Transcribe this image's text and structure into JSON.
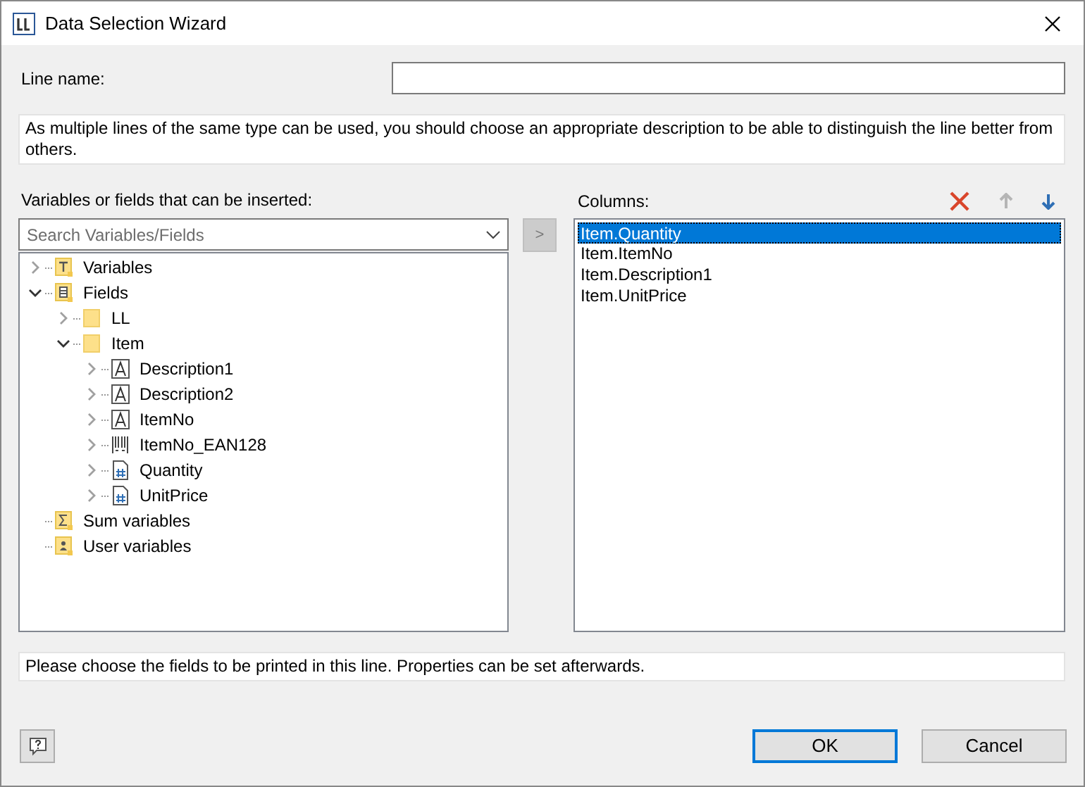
{
  "window": {
    "title": "Data Selection Wizard"
  },
  "line_name": {
    "label": "Line name:"
  },
  "description": "As multiple lines of the same type can be used, you should choose an appropriate description to be able to distinguish the line better from others.",
  "source": {
    "label": "Variables or fields that can be inserted:",
    "search_placeholder": "Search Variables/Fields",
    "add_button": ">",
    "tree": [
      {
        "label": "Variables",
        "kind": "variables",
        "expandable": true,
        "expanded": false
      },
      {
        "label": "Fields",
        "kind": "table",
        "expandable": true,
        "expanded": true,
        "children": [
          {
            "label": "LL",
            "kind": "folder",
            "expandable": true,
            "expanded": false
          },
          {
            "label": "Item",
            "kind": "folder",
            "expandable": true,
            "expanded": true,
            "children": [
              {
                "label": "Description1",
                "kind": "text",
                "expandable": true,
                "expanded": false
              },
              {
                "label": "Description2",
                "kind": "text",
                "expandable": true,
                "expanded": false
              },
              {
                "label": "ItemNo",
                "kind": "text",
                "expandable": true,
                "expanded": false
              },
              {
                "label": "ItemNo_EAN128",
                "kind": "barcode",
                "expandable": true,
                "expanded": false
              },
              {
                "label": "Quantity",
                "kind": "number",
                "expandable": true,
                "expanded": false
              },
              {
                "label": "UnitPrice",
                "kind": "number",
                "expandable": true,
                "expanded": false
              }
            ]
          }
        ]
      },
      {
        "label": "Sum variables",
        "kind": "sum"
      },
      {
        "label": "User variables",
        "kind": "user"
      }
    ]
  },
  "columns": {
    "label": "Columns:",
    "items": [
      {
        "label": "Item.Quantity",
        "selected": true
      },
      {
        "label": "Item.ItemNo",
        "selected": false
      },
      {
        "label": "Item.Description1",
        "selected": false
      },
      {
        "label": "Item.UnitPrice",
        "selected": false
      }
    ],
    "move_up_disabled": true,
    "move_down_disabled": false
  },
  "hint": "Please choose the fields to be printed in this line. Properties can be set afterwards.",
  "buttons": [
    {
      "label": "OK",
      "default": true
    },
    {
      "label": "Cancel",
      "default": false
    }
  ]
}
